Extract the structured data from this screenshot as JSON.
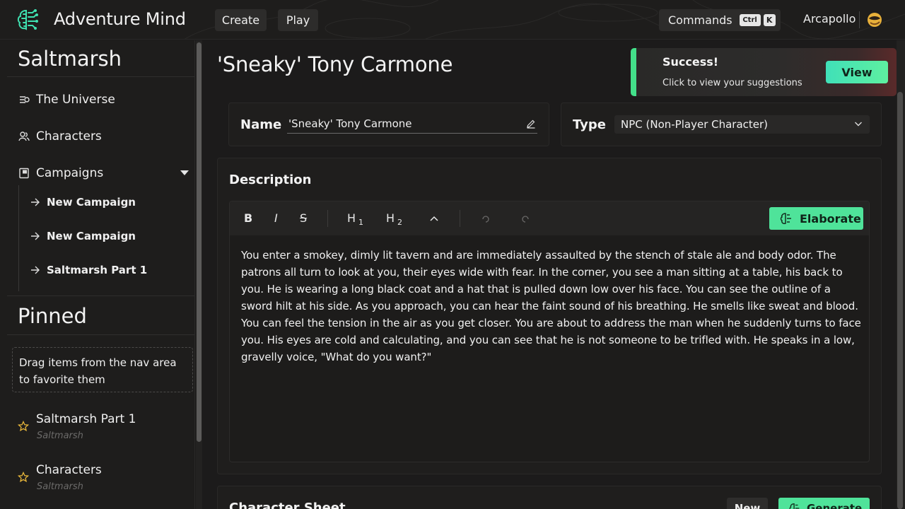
{
  "app": {
    "title": "Adventure Mind"
  },
  "nav": {
    "create": "Create",
    "play": "Play"
  },
  "commands": {
    "label": "Commands",
    "key1": "Ctrl",
    "key2": "K"
  },
  "user": {
    "name": "Arcapollo"
  },
  "sidebar": {
    "world_title": "Saltmarsh",
    "items": [
      {
        "label": "The Universe",
        "icon": "universe-icon"
      },
      {
        "label": "Characters",
        "icon": "characters-icon"
      },
      {
        "label": "Campaigns",
        "icon": "campaign-book-icon"
      }
    ],
    "campaigns": [
      "New Campaign",
      "New Campaign",
      "Saltmarsh Part 1"
    ],
    "pinned_title": "Pinned",
    "drag_hint": "Drag items from the nav area to favorite them",
    "pinned": [
      {
        "title": "Saltmarsh Part 1",
        "subtitle": "Saltmarsh"
      },
      {
        "title": "Characters",
        "subtitle": "Saltmarsh"
      }
    ]
  },
  "page": {
    "title": "'Sneaky' Tony Carmone"
  },
  "toast": {
    "title": "Success!",
    "message": "Click to view your suggestions",
    "button": "View",
    "accent": "#43e08a"
  },
  "form": {
    "name_label": "Name",
    "name_value": "'Sneaky' Tony Carmone",
    "type_label": "Type",
    "type_value": "NPC (Non-Player Character)"
  },
  "description": {
    "label": "Description",
    "toolbar": {
      "bold": "B",
      "italic": "I",
      "strike": "S",
      "h1": "H",
      "h1_sub": "1",
      "h2": "H",
      "h2_sub": "2"
    },
    "elaborate": "Elaborate",
    "text": "You enter a smokey, dimly lit tavern and are immediately assaulted by the stench of stale ale and body odor. The patrons all turn to look at you, their eyes wide with fear. In the corner, you see a man sitting at a table, his back to you. He is wearing a long black coat and a hat that is pulled down low over his face. You can see the outline of a sword hilt at his side. As you approach, you can hear the faint sound of his breathing. He smells like sweat and blood. You can feel the tension in the air as you get closer. You are about to address the man when he suddenly turns to face you. His eyes are cold and calculating, and you can see that he is not someone to be trifled with. He speaks in a low, gravelly voice, \"What do you want?\""
  },
  "character_sheet": {
    "title": "Character Sheet",
    "new": "New",
    "generate": "Generate"
  },
  "colors": {
    "accent_green": "#4fe39a",
    "background": "#1c1b1b"
  }
}
